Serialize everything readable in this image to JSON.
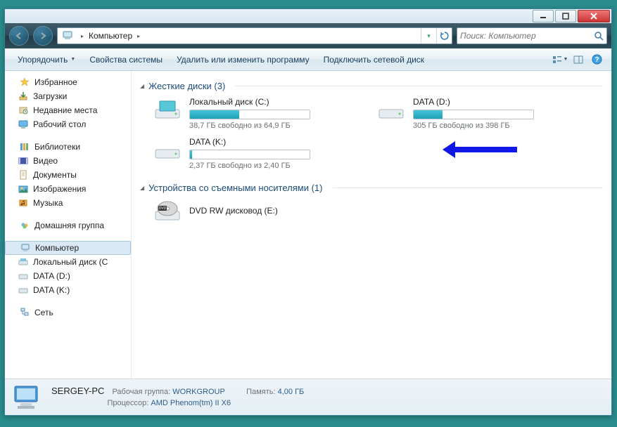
{
  "titlebar": {},
  "nav": {
    "breadcrumb": [
      "Компьютер"
    ],
    "search_placeholder": "Поиск: Компьютер"
  },
  "toolbar": {
    "organize": "Упорядочить",
    "props": "Свойства системы",
    "uninstall": "Удалить или изменить программу",
    "mapdrive": "Подключить сетевой диск"
  },
  "sidebar": {
    "favorites": {
      "label": "Избранное",
      "items": [
        "Загрузки",
        "Недавние места",
        "Рабочий стол"
      ]
    },
    "libraries": {
      "label": "Библиотеки",
      "items": [
        "Видео",
        "Документы",
        "Изображения",
        "Музыка"
      ]
    },
    "homegroup": {
      "label": "Домашняя группа"
    },
    "computer": {
      "label": "Компьютер",
      "items": [
        "Локальный диск (C",
        "DATA (D:)",
        "DATA (K:)"
      ]
    },
    "network": {
      "label": "Сеть"
    }
  },
  "sections": {
    "hdd": {
      "title": "Жесткие диски (3)"
    },
    "removable": {
      "title": "Устройства со съемными носителями (1)"
    }
  },
  "drives": [
    {
      "name": "Локальный диск (C:)",
      "fill_pct": 41,
      "info": "38,7 ГБ свободно из 64,9 ГБ"
    },
    {
      "name": "DATA (D:)",
      "fill_pct": 24,
      "info": "305 ГБ свободно из 398 ГБ"
    },
    {
      "name": "DATA (K:)",
      "fill_pct": 2,
      "info": "2,37 ГБ свободно из 2,40 ГБ"
    }
  ],
  "removable": [
    {
      "name": "DVD RW дисковод (E:)"
    }
  ],
  "details": {
    "name": "SERGEY-PC",
    "workgroup_lbl": "Рабочая группа:",
    "workgroup": "WORKGROUP",
    "mem_lbl": "Память:",
    "mem": "4,00 ГБ",
    "cpu_lbl": "Процессор:",
    "cpu": "AMD Phenom(tm) II X6"
  }
}
